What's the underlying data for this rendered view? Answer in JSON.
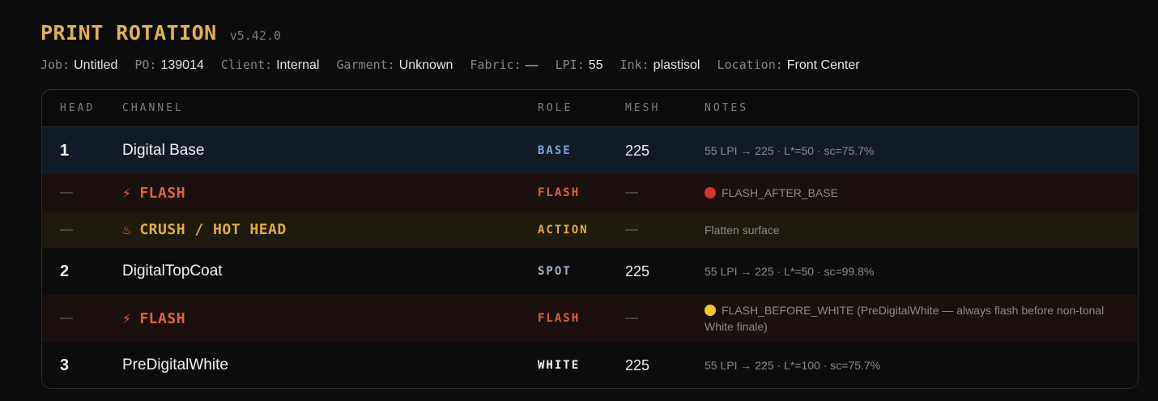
{
  "app": {
    "title": "PRINT ROTATION",
    "version": "v5.42.0"
  },
  "meta": [
    {
      "label": "Job:",
      "value": "Untitled"
    },
    {
      "label": "PO:",
      "value": "139014"
    },
    {
      "label": "Client:",
      "value": "Internal"
    },
    {
      "label": "Garment:",
      "value": "Unknown"
    },
    {
      "label": "Fabric:",
      "value": "—"
    },
    {
      "label": "LPI:",
      "value": "55"
    },
    {
      "label": "Ink:",
      "value": "plastisol"
    },
    {
      "label": "Location:",
      "value": "Front Center"
    }
  ],
  "columns": {
    "head": "HEAD",
    "channel": "CHANNEL",
    "role": "ROLE",
    "mesh": "MESH",
    "notes": "NOTES"
  },
  "rows": [
    {
      "head": "1",
      "icon": "",
      "channel": "Digital Base",
      "role": "BASE",
      "mesh": "225",
      "notes": "55 LPI → 225 · L*=50 · sc=75.7%"
    },
    {
      "head": "—",
      "icon": "⚡",
      "channel": "FLASH",
      "role": "FLASH",
      "mesh": "—",
      "notes": "FLASH_AFTER_BASE"
    },
    {
      "head": "—",
      "icon": "♨",
      "channel": "CRUSH / HOT HEAD",
      "role": "ACTION",
      "mesh": "—",
      "notes": "Flatten surface"
    },
    {
      "head": "2",
      "icon": "",
      "channel": "DigitalTopCoat",
      "role": "SPOT",
      "mesh": "225",
      "notes": "55 LPI → 225 · L*=50 · sc=99.8%"
    },
    {
      "head": "—",
      "icon": "⚡",
      "channel": "FLASH",
      "role": "FLASH",
      "mesh": "—",
      "notes": "FLASH_BEFORE_WHITE (PreDigitalWhite — always flash before non-tonal White finale)"
    },
    {
      "head": "3",
      "icon": "",
      "channel": "PreDigitalWhite",
      "role": "WHITE",
      "mesh": "225",
      "notes": "55 LPI → 225 · L*=100 · sc=75.7%"
    }
  ],
  "colors": {
    "accent": "#e3b14f",
    "flash": "#e0643f",
    "action": "#e0ad44",
    "base_role": "#7aa4d8",
    "spot_role": "#9fb0cc",
    "white_role": "#f2f2f2",
    "dot_red": "#d8312a",
    "dot_yellow": "#f2c530"
  },
  "icons": {
    "flash": "lightning-icon",
    "crush": "hot-springs-icon",
    "dot_red": "red-circle-icon",
    "dot_yellow": "yellow-circle-icon"
  }
}
